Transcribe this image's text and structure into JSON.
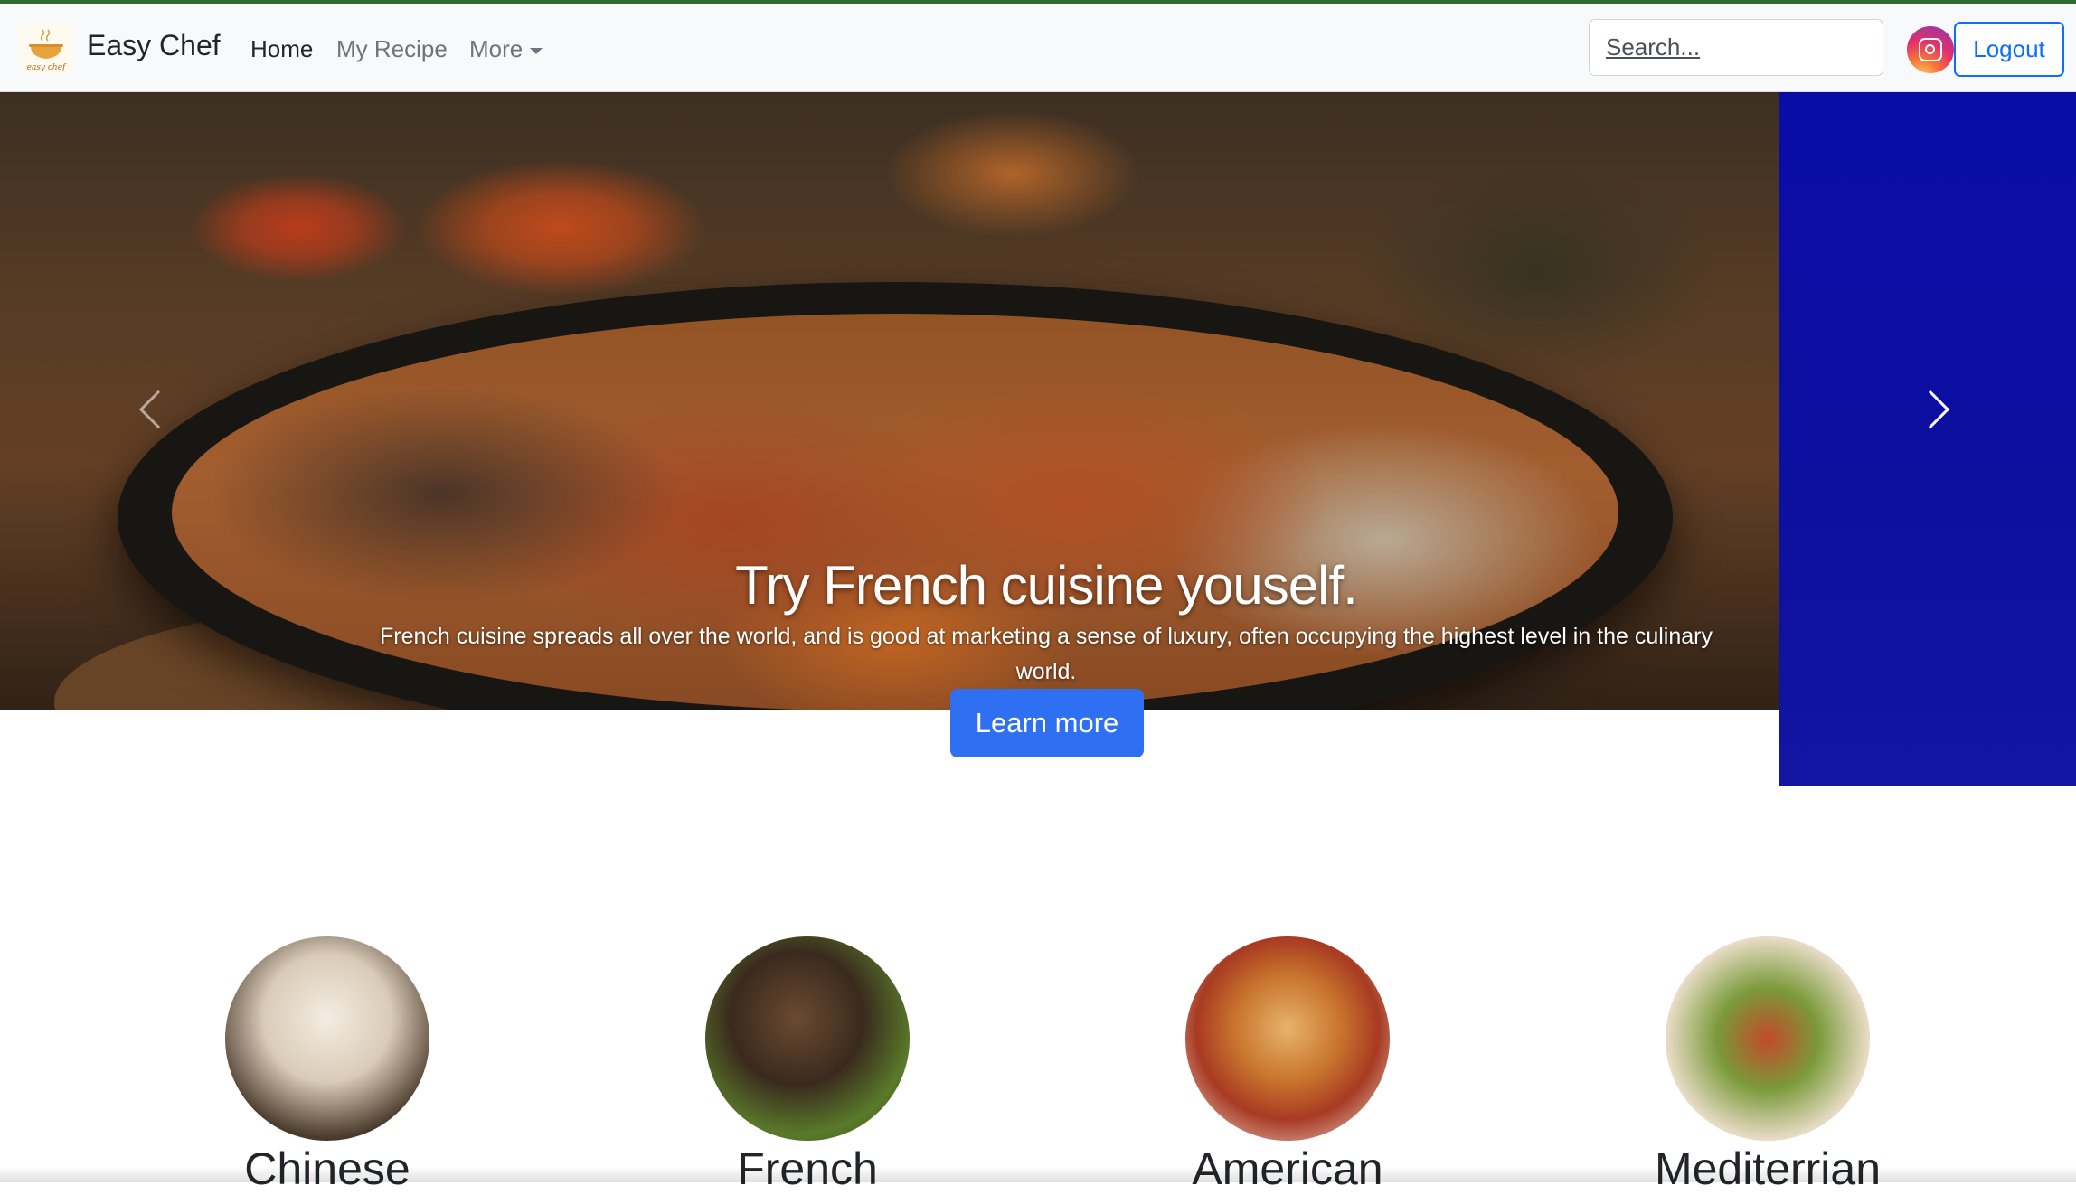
{
  "navbar": {
    "brand": "Easy Chef",
    "logo_text": "easy chef",
    "links": [
      "Home",
      "My Recipe",
      "More"
    ],
    "search_placeholder": "Search...",
    "logout_label": "Logout"
  },
  "hero": {
    "title": "Try French cuisine youself.",
    "text": "French cuisine spreads all over the world, and is good at marketing a sense of luxury, often occupying the highest level in the culinary world.",
    "cta": "Learn more"
  },
  "cuisines": [
    {
      "label": "Chinese"
    },
    {
      "label": "French"
    },
    {
      "label": "American"
    },
    {
      "label": "Mediterrian"
    }
  ],
  "colors": {
    "primary": "#0d6efd",
    "hero_side": "#0a0ca8"
  }
}
